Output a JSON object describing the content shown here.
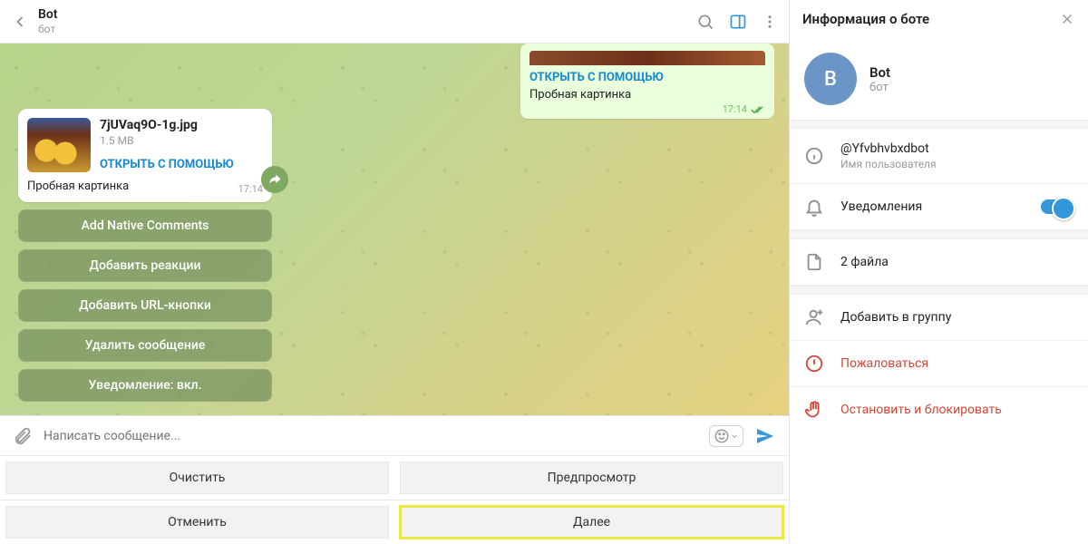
{
  "header": {
    "name": "Bot",
    "sub": "бот"
  },
  "out_msg": {
    "open": "ОТКРЫТЬ С ПОМОЩЬЮ",
    "caption": "Пробная картинка",
    "time": "17:14"
  },
  "in_msg": {
    "filename": "7jUVaq9O-1g.jpg",
    "size": "1.5 MB",
    "open": "ОТКРЫТЬ С ПОМОЩЬЮ",
    "caption": "Пробная картинка",
    "time": "17:14"
  },
  "keyboard": [
    "Add Native Comments",
    "Добавить реакции",
    "Добавить URL-кнопки",
    "Удалить сообщение",
    "Уведомление: вкл."
  ],
  "compose": {
    "placeholder": "Написать сообщение..."
  },
  "bottom": {
    "clear": "Очистить",
    "preview": "Предпросмотр",
    "cancel": "Отменить",
    "next": "Далее"
  },
  "side": {
    "title": "Информация о боте",
    "avatar": "B",
    "name": "Bot",
    "sub": "бот",
    "username": "@Yfvbhvbxdbot",
    "username_label": "Имя пользователя",
    "notif": "Уведомления",
    "files": "2 файла",
    "addgroup": "Добавить в группу",
    "report": "Пожаловаться",
    "stop": "Остановить и блокировать"
  }
}
